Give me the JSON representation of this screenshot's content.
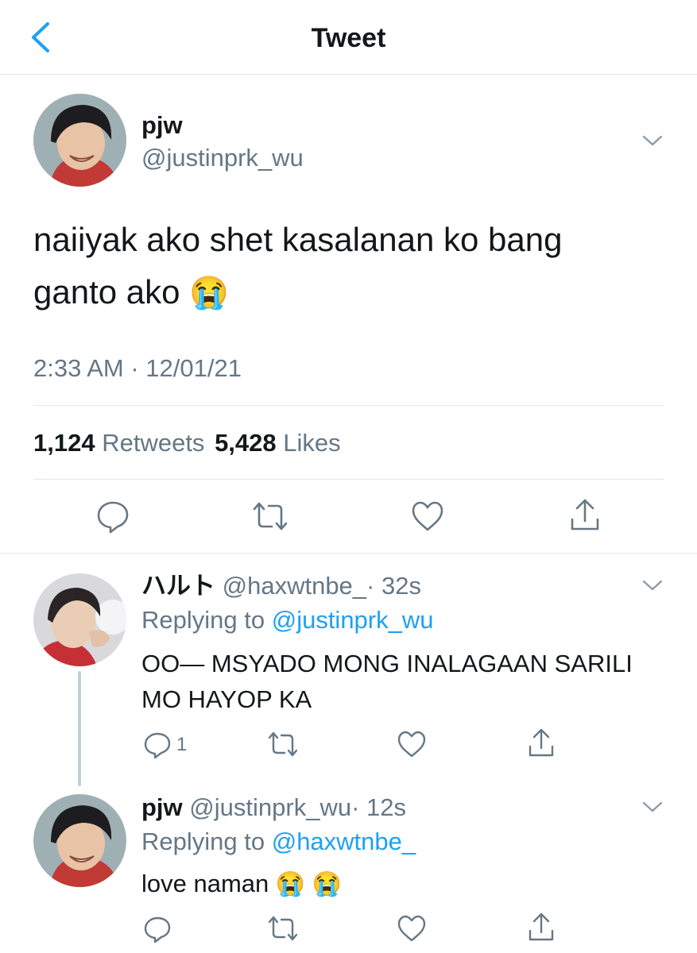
{
  "header": {
    "title": "Tweet"
  },
  "main_tweet": {
    "name": "pjw",
    "handle": "@justinprk_wu",
    "text_line1": "naiiyak ako shet kasalanan ko bang",
    "text_line2": "ganto ako",
    "emoji": "😭",
    "timestamp": "2:33 AM · 12/01/21",
    "retweets_count": "1,124",
    "retweets_label": "Retweets",
    "likes_count": "5,428",
    "likes_label": "Likes"
  },
  "replies": [
    {
      "name": "ハルト",
      "handle": "@haxwtnbe_",
      "time": "· 32s",
      "replying_prefix": "Replying to",
      "replying_to": "@justinprk_wu",
      "text_line1": "OO— MSYADO MONG INALAGAAN SARILI",
      "text_line2": "MO HAYOP KA",
      "reply_count": "1"
    },
    {
      "name": "pjw",
      "handle": "@justinprk_wu",
      "time": "· 12s",
      "replying_prefix": "Replying to",
      "replying_to": "@haxwtnbe_",
      "text": "love naman",
      "emoji": "😭 😭"
    }
  ],
  "icons": {
    "back": "chevron-left-icon",
    "caret": "chevron-down-icon",
    "reply": "speech-bubble-icon",
    "retweet": "retweet-icon",
    "like": "heart-icon",
    "share": "share-icon"
  },
  "colors": {
    "accent": "#1da1f2",
    "secondary_text": "#657786",
    "divider": "#e1e8ed"
  }
}
